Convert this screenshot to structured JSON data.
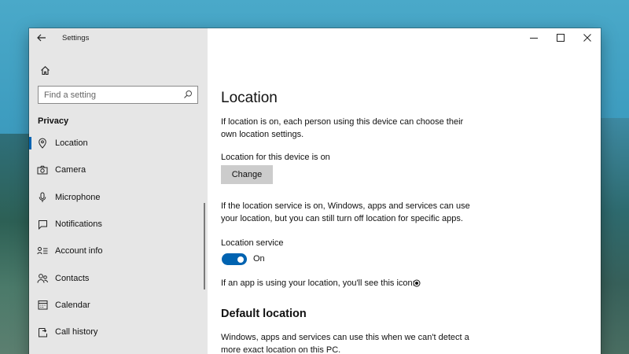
{
  "window": {
    "title": "Settings",
    "controls": [
      "minimize",
      "maximize",
      "close"
    ]
  },
  "sidebar": {
    "search_placeholder": "Find a setting",
    "section": "Privacy",
    "items": [
      {
        "label": "Location",
        "icon": "location-icon",
        "active": true
      },
      {
        "label": "Camera",
        "icon": "camera-icon"
      },
      {
        "label": "Microphone",
        "icon": "microphone-icon"
      },
      {
        "label": "Notifications",
        "icon": "notifications-icon"
      },
      {
        "label": "Account info",
        "icon": "account-info-icon"
      },
      {
        "label": "Contacts",
        "icon": "contacts-icon"
      },
      {
        "label": "Calendar",
        "icon": "calendar-icon"
      },
      {
        "label": "Call history",
        "icon": "call-history-icon"
      }
    ]
  },
  "main": {
    "title": "Location",
    "intro": "If location is on, each person using this device can choose their own location settings.",
    "device_status": "Location for this device is on",
    "change_button": "Change",
    "service_desc": "If the location service is on, Windows, apps and services can use your location, but you can still turn off location for specific apps.",
    "service_label": "Location service",
    "service_toggle": {
      "state": "On",
      "on": true
    },
    "indicator_text": "If an app is using your location, you'll see this icon:",
    "default_heading": "Default location",
    "default_desc": "Windows, apps and services can use this when we can't detect a more exact location on this PC."
  },
  "colors": {
    "accent": "#0063b1",
    "sidebar_bg": "#e6e6e6",
    "content_bg": "#ffffff",
    "button_bg": "#cccccc"
  }
}
